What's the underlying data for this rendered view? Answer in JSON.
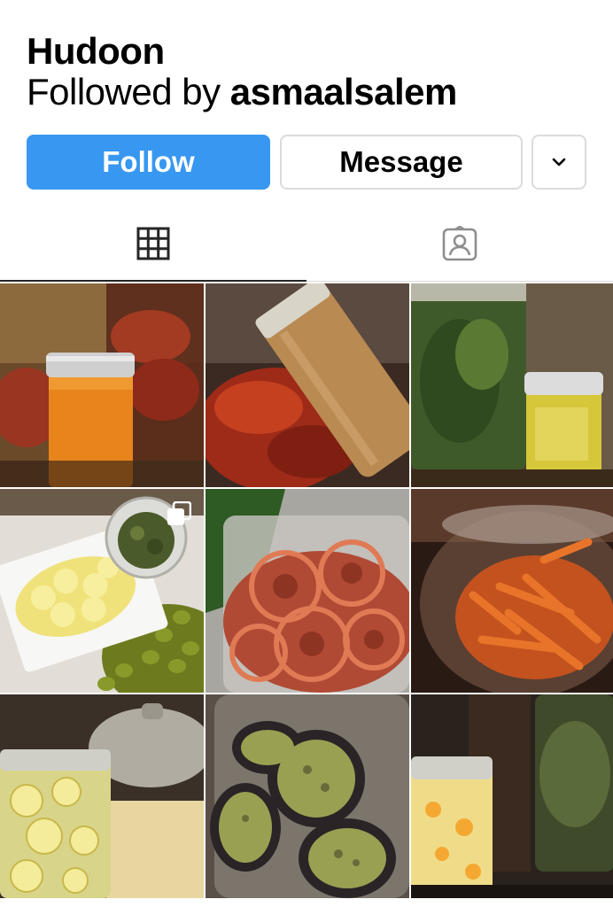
{
  "profile": {
    "name": "Hudoon",
    "followed_prefix": "Followed by ",
    "followed_user": "asmaalsalem"
  },
  "actions": {
    "follow_label": "Follow",
    "message_label": "Message",
    "more_icon": "chevron-down-icon"
  },
  "tabs": [
    {
      "icon": "grid-icon",
      "active": true
    },
    {
      "icon": "tagged-person-icon",
      "active": false
    }
  ],
  "posts": [
    {
      "subject": "jar of ground spice with dried peppers",
      "multiple": false
    },
    {
      "subject": "spice jar lying on dried chili flakes",
      "multiple": false
    },
    {
      "subject": "jars of herbs in olive oil",
      "multiple": false
    },
    {
      "subject": "sliced lemons, green olives and dried herbs",
      "multiple": true
    },
    {
      "subject": "dried tomato slices in container",
      "multiple": false
    },
    {
      "subject": "dried carrot strips in glass jar",
      "multiple": false
    },
    {
      "subject": "jar of pickled lemons near pot",
      "multiple": false
    },
    {
      "subject": "dried eggplant slices in jar",
      "multiple": false
    },
    {
      "subject": "jars of pickles and dried mint",
      "multiple": false
    }
  ],
  "colors": {
    "follow_button": "#3897f0",
    "border": "#dbdbdb",
    "text": "#000000"
  }
}
